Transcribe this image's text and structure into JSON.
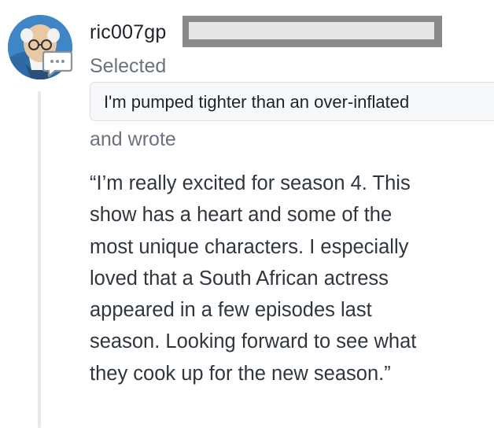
{
  "comment": {
    "username": "ric007gp",
    "action_selected": "Selected",
    "selected_option": "I'm pumped tighter than an over-inflated",
    "action_wrote": "and wrote",
    "quote_lines": [
      "“I’m really excited for season 4. This",
      "show has a heart and some of the",
      "most unique characters. I especially",
      "loved that a South African actress",
      "appeared in a few episodes last",
      "season. Looking forward to see what",
      "they cook up for the new season.”"
    ]
  },
  "icons": {
    "avatar": "user-avatar-icon",
    "badge": "comment-icon"
  },
  "colors": {
    "username": "#1f2328",
    "muted": "#6a737d",
    "thread_line": "#e6e8eb",
    "avatar_bg": "#3f86c6"
  }
}
